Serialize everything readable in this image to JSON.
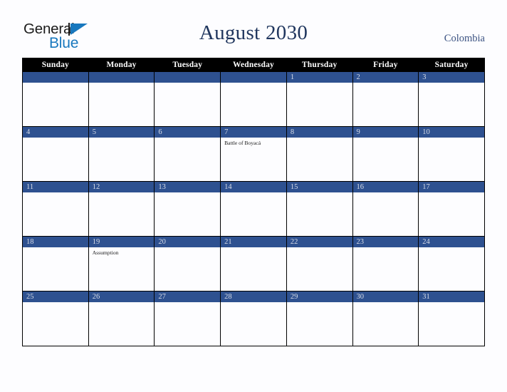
{
  "logo": {
    "word_one": "General",
    "word_two": "Blue",
    "triangle_color": "#1878be",
    "text_color": "#1b1b1b"
  },
  "header": {
    "title": "August 2030",
    "country": "Colombia",
    "title_color": "#20365e",
    "country_color": "#3b5282"
  },
  "calendar": {
    "accent_color": "#2e5190",
    "header_bg": "#000000",
    "weekdays": [
      "Sunday",
      "Monday",
      "Tuesday",
      "Wednesday",
      "Thursday",
      "Friday",
      "Saturday"
    ],
    "weeks": [
      [
        {
          "day": "",
          "event": ""
        },
        {
          "day": "",
          "event": ""
        },
        {
          "day": "",
          "event": ""
        },
        {
          "day": "",
          "event": ""
        },
        {
          "day": "1",
          "event": ""
        },
        {
          "day": "2",
          "event": ""
        },
        {
          "day": "3",
          "event": ""
        }
      ],
      [
        {
          "day": "4",
          "event": ""
        },
        {
          "day": "5",
          "event": ""
        },
        {
          "day": "6",
          "event": ""
        },
        {
          "day": "7",
          "event": "Battle of Boyacá"
        },
        {
          "day": "8",
          "event": ""
        },
        {
          "day": "9",
          "event": ""
        },
        {
          "day": "10",
          "event": ""
        }
      ],
      [
        {
          "day": "11",
          "event": ""
        },
        {
          "day": "12",
          "event": ""
        },
        {
          "day": "13",
          "event": ""
        },
        {
          "day": "14",
          "event": ""
        },
        {
          "day": "15",
          "event": ""
        },
        {
          "day": "16",
          "event": ""
        },
        {
          "day": "17",
          "event": ""
        }
      ],
      [
        {
          "day": "18",
          "event": ""
        },
        {
          "day": "19",
          "event": "Assumption"
        },
        {
          "day": "20",
          "event": ""
        },
        {
          "day": "21",
          "event": ""
        },
        {
          "day": "22",
          "event": ""
        },
        {
          "day": "23",
          "event": ""
        },
        {
          "day": "24",
          "event": ""
        }
      ],
      [
        {
          "day": "25",
          "event": ""
        },
        {
          "day": "26",
          "event": ""
        },
        {
          "day": "27",
          "event": ""
        },
        {
          "day": "28",
          "event": ""
        },
        {
          "day": "29",
          "event": ""
        },
        {
          "day": "30",
          "event": ""
        },
        {
          "day": "31",
          "event": ""
        }
      ]
    ]
  }
}
